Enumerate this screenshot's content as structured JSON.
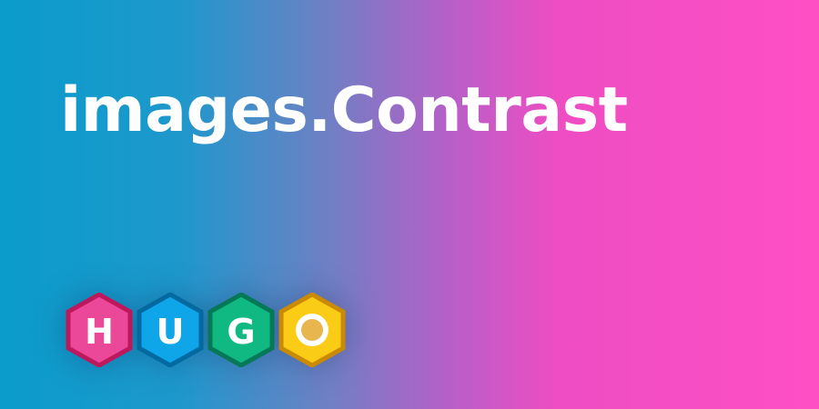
{
  "banner": {
    "title": "images.Contrast"
  },
  "logo": {
    "letters": [
      "H",
      "U",
      "G",
      "O"
    ],
    "colors": {
      "h_fill": "#ec4899",
      "h_stroke": "#be185d",
      "u_fill": "#0ea5e9",
      "u_stroke": "#0369a1",
      "g_fill": "#10b981",
      "g_stroke": "#047857",
      "o_fill": "#facc15",
      "o_stroke": "#ca8a04",
      "o_inner": "#e7b64e"
    }
  },
  "colors": {
    "gradient_left": "#0a9ccc",
    "gradient_right": "#ff4fc5",
    "title_text": "#ffffff"
  }
}
